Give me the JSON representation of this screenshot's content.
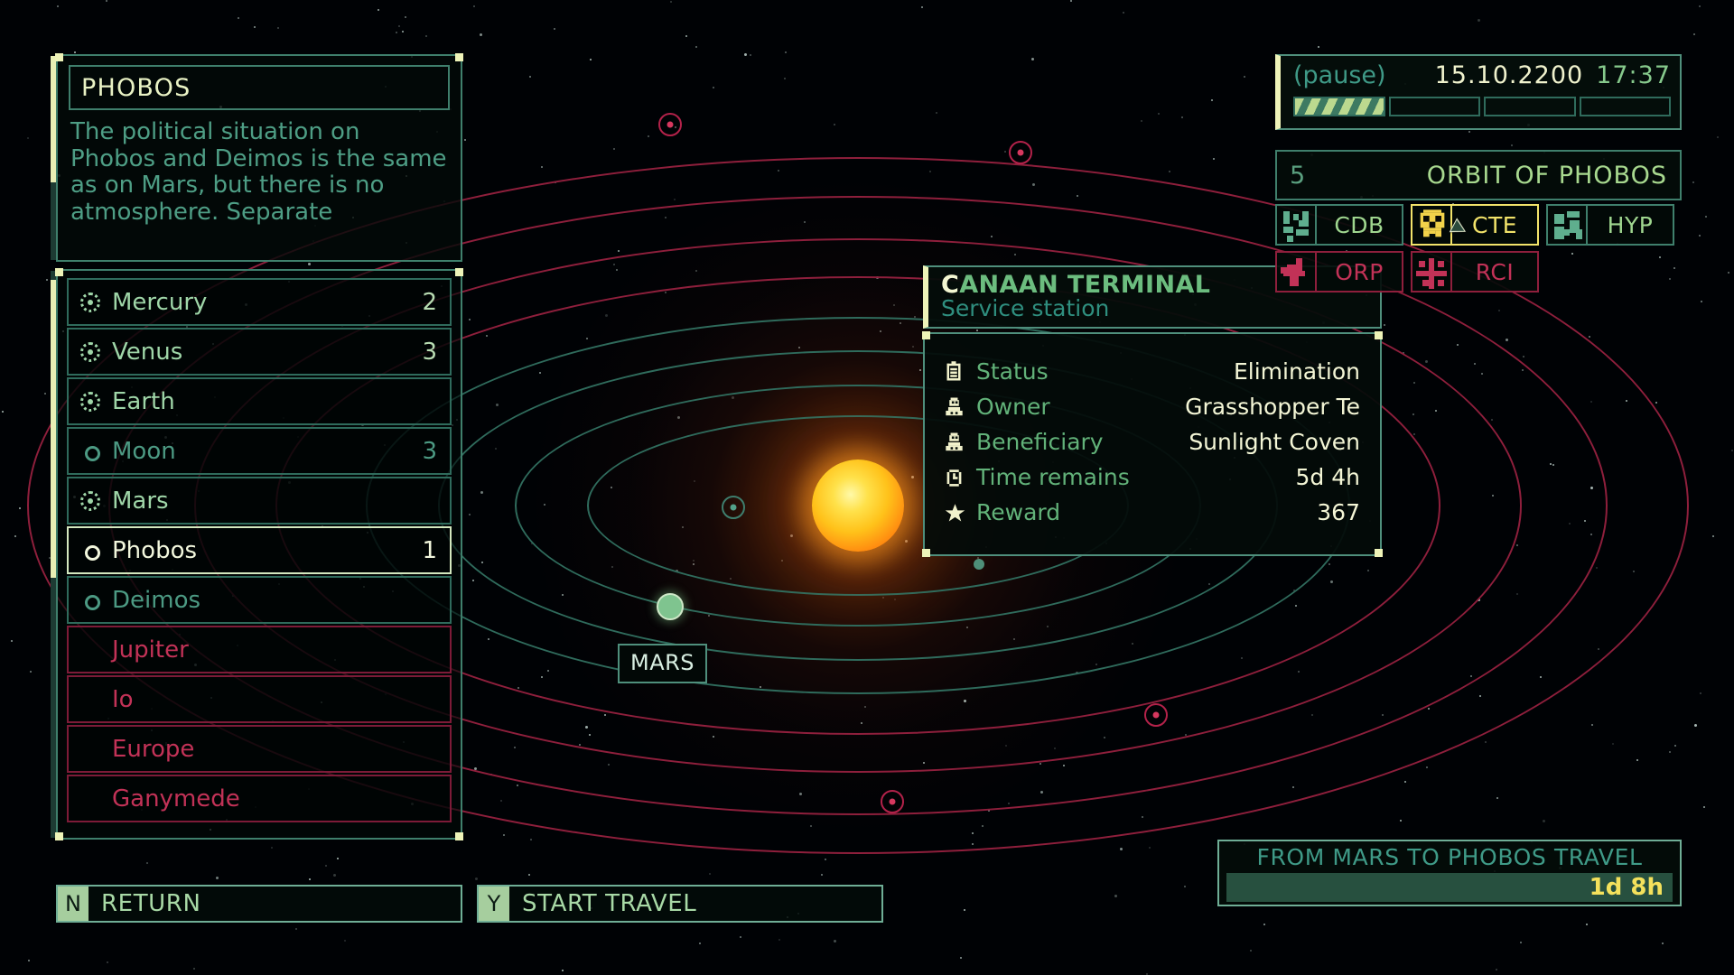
{
  "colors": {
    "green": "#3f7f6c",
    "green_text": "#9fd6a8",
    "teal_text": "#3f9a87",
    "cream": "#f2f7dd",
    "yellow": "#f2e36a",
    "red": "#c23257",
    "orbit_red": "#8e1f3c"
  },
  "description": {
    "title": "PHOBOS",
    "body": "The political situation on Phobos and Deimos is the same as on Mars, but there is no atmosphere. Separate"
  },
  "planet_list": [
    {
      "name": "Mercury",
      "count": "2",
      "kind": "planet",
      "state": "normal"
    },
    {
      "name": "Venus",
      "count": "3",
      "kind": "planet",
      "state": "normal"
    },
    {
      "name": "Earth",
      "count": "",
      "kind": "planet",
      "state": "normal"
    },
    {
      "name": "Moon",
      "count": "3",
      "kind": "moon",
      "state": "moon"
    },
    {
      "name": "Mars",
      "count": "",
      "kind": "planet",
      "state": "normal"
    },
    {
      "name": "Phobos",
      "count": "1",
      "kind": "moon",
      "state": "selected"
    },
    {
      "name": "Deimos",
      "count": "",
      "kind": "moon",
      "state": "moon"
    },
    {
      "name": "Jupiter",
      "count": "",
      "kind": "none",
      "state": "locked"
    },
    {
      "name": "Io",
      "count": "",
      "kind": "none",
      "state": "locked"
    },
    {
      "name": "Europe",
      "count": "",
      "kind": "none",
      "state": "locked"
    },
    {
      "name": "Ganymede",
      "count": "",
      "kind": "none",
      "state": "locked"
    }
  ],
  "map": {
    "mars_label": "MARS"
  },
  "info_card": {
    "title_first": "C",
    "title_rest": "ANAAN TERMINAL",
    "subtitle": "Service station",
    "rows": [
      {
        "icon": "clipboard-icon",
        "label": "Status",
        "value": "Elimination"
      },
      {
        "icon": "person-icon",
        "label": "Owner",
        "value": "Grasshopper Te"
      },
      {
        "icon": "person-icon",
        "label": "Beneficiary",
        "value": "Sunlight Coven"
      },
      {
        "icon": "clock-icon",
        "label": "Time remains",
        "value": "5d 4h"
      },
      {
        "icon": "star-icon",
        "label": "Reward",
        "value": "367"
      }
    ]
  },
  "hud": {
    "pause_label": "(pause)",
    "date": "15.10.2200",
    "clock": "17:37",
    "speed_segments": [
      true,
      false,
      false,
      false
    ],
    "orbit_number": "5",
    "orbit_title": "ORBIT OF PHOBOS",
    "factions": [
      {
        "code": "CDB",
        "state": "normal"
      },
      {
        "code": "CTE",
        "state": "active"
      },
      {
        "code": "HYP",
        "state": "normal"
      },
      {
        "code": "ORP",
        "state": "hostile"
      },
      {
        "code": "RCI",
        "state": "hostile"
      }
    ]
  },
  "footer": {
    "return_key": "N",
    "return_label": "RETURN",
    "travel_key": "Y",
    "travel_label": "START TRAVEL"
  },
  "travel_panel": {
    "title": "FROM MARS TO PHOBOS TRAVEL",
    "duration": "1d 8h"
  }
}
